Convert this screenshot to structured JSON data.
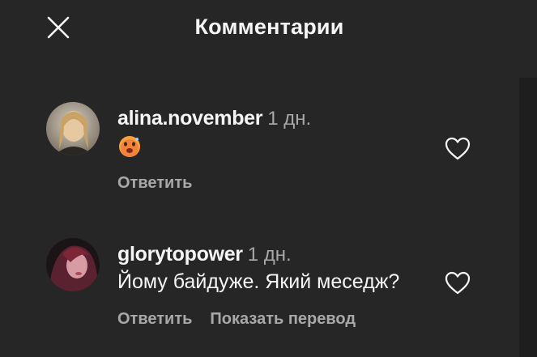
{
  "header": {
    "title": "Комментарии",
    "close_icon": "close-icon"
  },
  "comments": [
    {
      "username": "alina.november",
      "time": "1 дн.",
      "text": "",
      "emoji": "hot-face-emoji",
      "reply_label": "Ответить",
      "like_icon": "heart-outline-icon"
    },
    {
      "username": "glorytopower",
      "time": "1 дн.",
      "text": "Йому байдуже. Який меседж?",
      "reply_label": "Ответить",
      "translate_label": "Показать перевод",
      "like_icon": "heart-outline-icon"
    }
  ],
  "colors": {
    "background": "#262626",
    "text": "#f5f5f5",
    "secondary": "#a8a8a8"
  }
}
